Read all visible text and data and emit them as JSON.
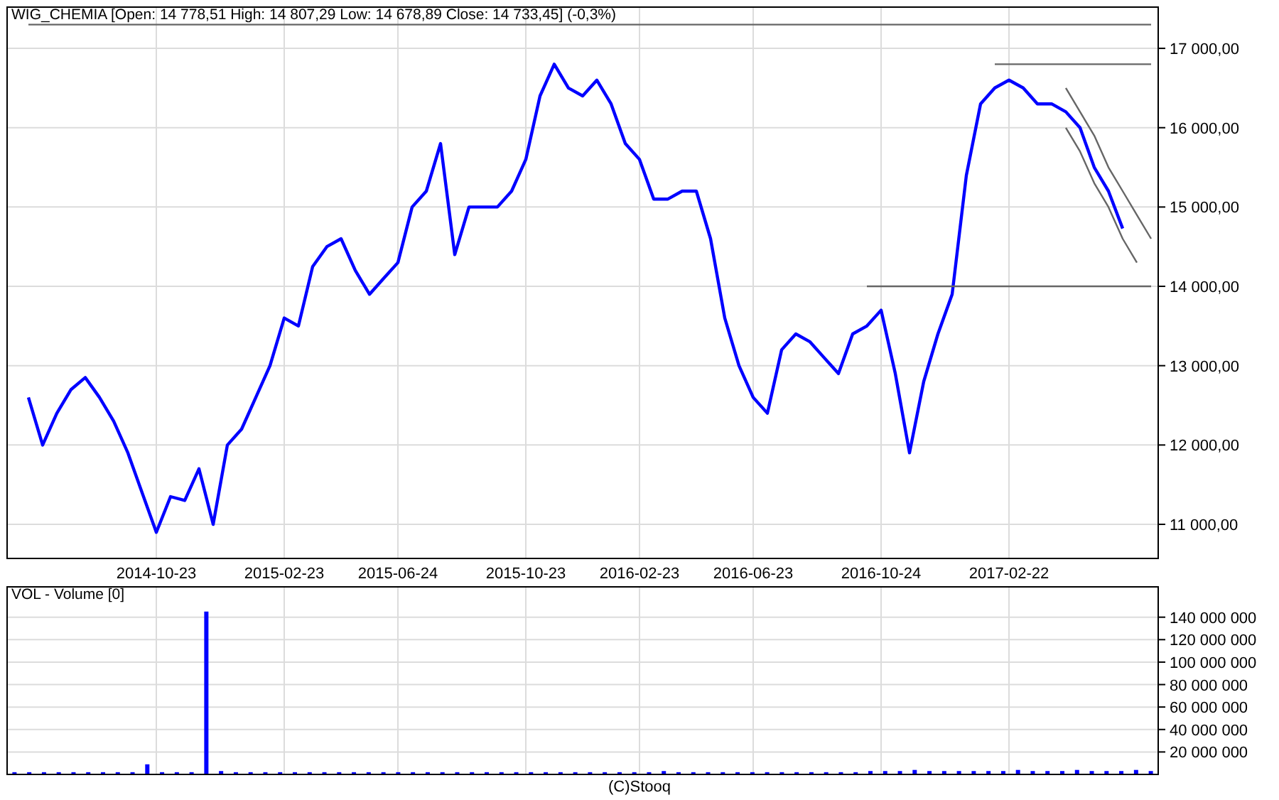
{
  "charts": [
    {
      "title": "WIG_CHEMIA [Open: 14 778,51  High: 14 807,29  Low: 14 678,89  Close: 14 733,45] (-0,3%)",
      "chart_data": {
        "type": "line",
        "grid": true,
        "ylim": [
          10570,
          17520
        ],
        "categories": [
          null,
          null,
          null,
          null,
          null,
          null,
          null,
          null,
          null,
          "2014-10-23",
          null,
          null,
          null,
          null,
          null,
          null,
          null,
          null,
          "2015-02-23",
          null,
          null,
          null,
          null,
          null,
          null,
          null,
          "2015-06-24",
          null,
          null,
          null,
          null,
          null,
          null,
          null,
          null,
          "2015-10-23",
          null,
          null,
          null,
          null,
          null,
          null,
          null,
          "2016-02-23",
          null,
          null,
          null,
          null,
          null,
          null,
          null,
          "2016-06-23",
          null,
          null,
          null,
          null,
          null,
          null,
          null,
          null,
          "2016-10-24",
          null,
          null,
          null,
          null,
          null,
          null,
          null,
          null,
          "2017-02-22",
          null,
          null,
          null,
          null,
          null,
          null,
          null,
          null,
          null,
          null
        ],
        "series": [
          {
            "color": "#0000ff",
            "values": [
              12600,
              12000,
              12400,
              12700,
              12850,
              12600,
              12300,
              11900,
              11400,
              10900,
              11350,
              11300,
              11700,
              11000,
              12000,
              12200,
              12600,
              13000,
              13600,
              13500,
              14250,
              14500,
              14600,
              14200,
              13900,
              14100,
              14300,
              15000,
              15200,
              15800,
              14400,
              15000,
              15000,
              15000,
              15200,
              15600,
              16400,
              16800,
              16500,
              16400,
              16600,
              16300,
              15800,
              15600,
              15100,
              15100,
              15200,
              15200,
              14600,
              13600,
              13000,
              12600,
              12400,
              13200,
              13400,
              13300,
              13100,
              12900,
              13400,
              13500,
              13700,
              12900,
              11900,
              12800,
              13400,
              13900,
              15400,
              16300,
              16500,
              16600,
              16500,
              16300,
              16300,
              16200,
              16000,
              15500,
              15200,
              14730,
              null,
              null
            ]
          },
          {
            "color": "#666666",
            "values": [
              null,
              null,
              null,
              null,
              null,
              null,
              null,
              null,
              null,
              null,
              null,
              null,
              null,
              null,
              null,
              null,
              null,
              null,
              null,
              null,
              null,
              null,
              null,
              null,
              null,
              null,
              null,
              null,
              null,
              null,
              null,
              null,
              null,
              null,
              null,
              null,
              null,
              null,
              null,
              null,
              null,
              null,
              null,
              null,
              null,
              null,
              null,
              null,
              null,
              null,
              null,
              null,
              null,
              null,
              null,
              null,
              null,
              null,
              null,
              null,
              null,
              null,
              null,
              null,
              null,
              null,
              null,
              null,
              16800,
              16800,
              16800,
              16800,
              16800,
              16800,
              16800,
              16800,
              16800,
              16800,
              16800,
              16800
            ]
          },
          {
            "color": "#666666",
            "values": [
              null,
              null,
              null,
              null,
              null,
              null,
              null,
              null,
              null,
              null,
              null,
              null,
              null,
              null,
              null,
              null,
              null,
              null,
              null,
              null,
              null,
              null,
              null,
              null,
              null,
              null,
              null,
              null,
              null,
              null,
              null,
              null,
              null,
              null,
              null,
              null,
              null,
              null,
              null,
              null,
              null,
              null,
              null,
              null,
              null,
              null,
              null,
              null,
              null,
              null,
              null,
              null,
              null,
              null,
              null,
              null,
              null,
              null,
              null,
              14000,
              14000,
              14000,
              14000,
              14000,
              14000,
              14000,
              14000,
              14000,
              14000,
              14000,
              14000,
              14000,
              14000,
              14000,
              14000,
              14000,
              14000,
              14000,
              14000,
              14000
            ]
          },
          {
            "color": "#666666",
            "values": [
              null,
              null,
              null,
              null,
              null,
              null,
              null,
              null,
              null,
              null,
              null,
              null,
              null,
              null,
              null,
              null,
              null,
              null,
              null,
              null,
              null,
              null,
              null,
              null,
              null,
              null,
              null,
              null,
              null,
              null,
              null,
              null,
              null,
              null,
              null,
              null,
              null,
              null,
              null,
              null,
              null,
              null,
              null,
              null,
              null,
              null,
              null,
              null,
              null,
              null,
              null,
              null,
              null,
              null,
              null,
              null,
              null,
              null,
              null,
              null,
              null,
              null,
              null,
              null,
              null,
              null,
              null,
              null,
              null,
              null,
              null,
              null,
              null,
              16500,
              16200,
              15900,
              15500,
              15200,
              14900,
              14600
            ]
          },
          {
            "color": "#666666",
            "values": [
              null,
              null,
              null,
              null,
              null,
              null,
              null,
              null,
              null,
              null,
              null,
              null,
              null,
              null,
              null,
              null,
              null,
              null,
              null,
              null,
              null,
              null,
              null,
              null,
              null,
              null,
              null,
              null,
              null,
              null,
              null,
              null,
              null,
              null,
              null,
              null,
              null,
              null,
              null,
              null,
              null,
              null,
              null,
              null,
              null,
              null,
              null,
              null,
              null,
              null,
              null,
              null,
              null,
              null,
              null,
              null,
              null,
              null,
              null,
              null,
              null,
              null,
              null,
              null,
              null,
              null,
              null,
              null,
              null,
              null,
              null,
              null,
              null,
              16000,
              15700,
              15300,
              15000,
              14600,
              14300,
              null
            ]
          },
          {
            "color": "#666666",
            "values": [
              17300,
              17300,
              17300,
              17300,
              17300,
              17300,
              17300,
              17300,
              17300,
              17300,
              17300,
              17300,
              17300,
              17300,
              17300,
              17300,
              17300,
              17300,
              17300,
              17300,
              17300,
              17300,
              17300,
              17300,
              17300,
              17300,
              17300,
              17300,
              17300,
              17300,
              17300,
              17300,
              17300,
              17300,
              17300,
              17300,
              17300,
              17300,
              17300,
              17300,
              17300,
              17300,
              17300,
              17300,
              17300,
              17300,
              17300,
              17300,
              17300,
              17300,
              17300,
              17300,
              17300,
              17300,
              17300,
              17300,
              17300,
              17300,
              17300,
              17300,
              17300,
              17300,
              17300,
              17300,
              17300,
              17300,
              17300,
              17300,
              17300,
              17300,
              17300,
              17300,
              17300,
              17300,
              17300,
              17300,
              17300,
              17300,
              17300,
              17300
            ]
          }
        ],
        "yticks": [
          {
            "value": 11000,
            "label": "11 000,00"
          },
          {
            "value": 12000,
            "label": "12 000,00"
          },
          {
            "value": 13000,
            "label": "13 000,00"
          },
          {
            "value": 14000,
            "label": "14 000,00"
          },
          {
            "value": 15000,
            "label": "15 000,00"
          },
          {
            "value": 16000,
            "label": "16 000,00"
          },
          {
            "value": 17000,
            "label": "17 000,00"
          }
        ]
      }
    },
    {
      "title": "VOL - Volume [0]",
      "chart_data": {
        "type": "bar",
        "grid": true,
        "ylim": [
          0,
          167000000
        ],
        "categories": [
          null,
          null,
          null,
          null,
          null,
          null,
          null,
          null,
          null,
          null,
          null,
          null,
          null,
          null,
          null,
          null,
          null,
          null,
          null,
          null,
          null,
          null,
          null,
          null,
          null,
          null,
          null,
          null,
          null,
          null,
          null,
          null,
          null,
          null,
          null,
          null,
          null,
          null,
          null,
          null,
          null,
          null,
          null,
          null,
          null,
          null,
          null,
          null,
          null,
          null,
          null,
          null,
          null,
          null,
          null,
          null,
          null,
          null,
          null,
          null,
          null,
          null,
          null,
          null,
          null,
          null,
          null,
          null,
          null,
          null,
          null,
          null,
          null,
          null,
          null,
          null,
          null,
          null
        ],
        "series": [
          {
            "color": "#0000ff",
            "values": [
              2000000,
              2000000,
              2000000,
              2000000,
              2000000,
              2000000,
              2000000,
              2000000,
              2000000,
              9000000,
              2000000,
              2000000,
              2000000,
              145000000,
              3000000,
              2000000,
              2000000,
              2000000,
              2000000,
              2000000,
              2000000,
              2000000,
              2000000,
              2000000,
              2000000,
              2000000,
              2000000,
              2000000,
              2000000,
              2000000,
              2000000,
              2000000,
              2000000,
              2000000,
              2000000,
              2000000,
              2000000,
              2000000,
              2000000,
              2000000,
              2000000,
              2000000,
              2000000,
              2000000,
              3000000,
              2000000,
              2000000,
              2000000,
              2000000,
              2000000,
              2000000,
              2000000,
              2000000,
              2000000,
              2000000,
              2000000,
              2000000,
              2000000,
              3000000,
              3000000,
              3000000,
              4000000,
              3000000,
              3000000,
              3000000,
              3000000,
              3000000,
              3000000,
              4000000,
              3000000,
              3000000,
              3000000,
              4000000,
              3000000,
              3000000,
              3000000,
              4000000,
              3000000
            ]
          }
        ],
        "yticks": [
          {
            "value": 20000000,
            "label": "20 000 000"
          },
          {
            "value": 40000000,
            "label": "40 000 000"
          },
          {
            "value": 60000000,
            "label": "60 000 000"
          },
          {
            "value": 80000000,
            "label": "80 000 000"
          },
          {
            "value": 100000000,
            "label": "100 000 000"
          },
          {
            "value": 120000000,
            "label": "120 000 000"
          },
          {
            "value": 140000000,
            "label": "140 000 000"
          }
        ]
      }
    }
  ],
  "footer": "(C)Stooq"
}
